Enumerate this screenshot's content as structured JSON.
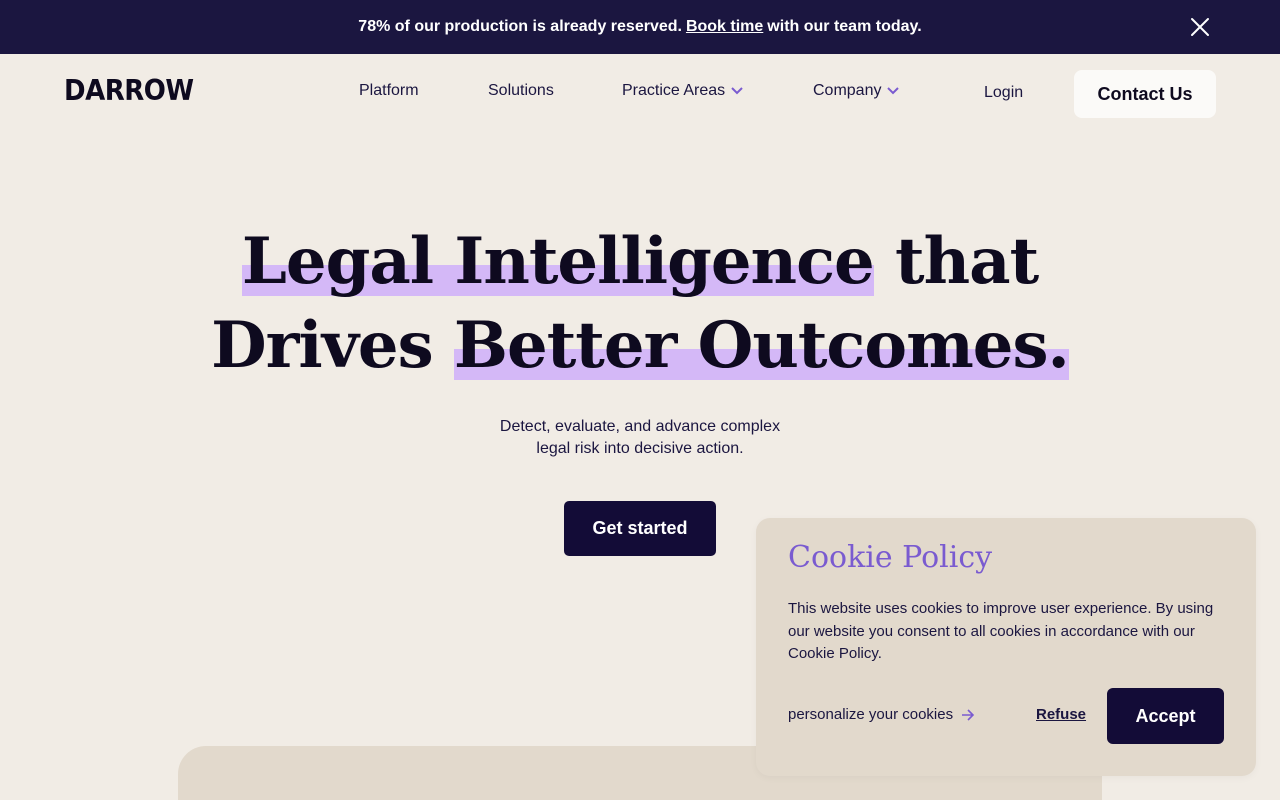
{
  "announcement": {
    "text_before": "78% of our production is already reserved.",
    "link_text": "Book time",
    "text_after": "with our team today."
  },
  "header": {
    "logo": "DARROW",
    "nav": {
      "platform": "Platform",
      "solutions": "Solutions",
      "practice_areas": "Practice Areas",
      "company": "Company"
    },
    "login": "Login",
    "contact": "Contact Us"
  },
  "hero": {
    "line1_highlight": "Legal Intelligence",
    "line1_rest": "that",
    "line2_plain": "Drives",
    "line2_highlight": "Better Outcomes.",
    "subtitle_line1": "Detect, evaluate, and advance complex",
    "subtitle_line2": "legal risk into decisive action.",
    "cta": "Get started"
  },
  "cookie": {
    "title": "Cookie Policy",
    "text": "This website uses cookies to improve user experience.  By using our website you consent to all cookies in accordance with our Cookie Policy.",
    "personalize": "personalize your cookies",
    "refuse": "Refuse",
    "accept": "Accept"
  },
  "colors": {
    "background": "#f1ece5",
    "navy": "#1b1640",
    "button": "#130c37",
    "highlight": "#d4b8f7",
    "accent_purple": "#7a5bd0"
  },
  "icons": {
    "close": "close-icon",
    "chevron": "chevron-down-icon",
    "arrow": "arrow-right-icon"
  }
}
